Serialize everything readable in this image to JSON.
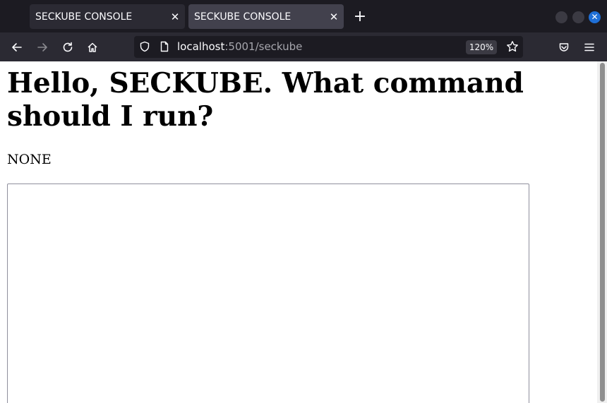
{
  "tabs": [
    {
      "title": "SECKUBE CONSOLE",
      "close": "✕"
    },
    {
      "title": "SECKUBE CONSOLE",
      "close": "✕"
    }
  ],
  "new_tab": "+",
  "window_controls": {
    "close": "✕"
  },
  "nav": {
    "back_icon": "arrow-left-icon",
    "forward_icon": "arrow-right-icon",
    "reload_icon": "reload-icon",
    "home_icon": "home-icon"
  },
  "address_bar": {
    "host": "localhost",
    "path": ":5001/seckube",
    "zoom": "120%"
  },
  "page": {
    "heading": "Hello, SECKUBE. What command should I run?",
    "result": "NONE",
    "command_value": ""
  }
}
